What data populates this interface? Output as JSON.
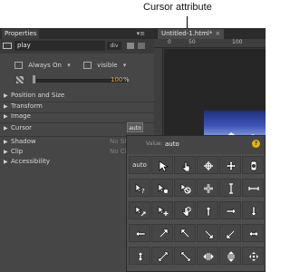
{
  "callout": {
    "text": "Cursor attribute"
  },
  "properties_panel": {
    "tab_label": "Properties",
    "menu_glyph": "▾≡",
    "element_name": "play",
    "element_type": "div",
    "overflow": "Always On",
    "visibility": "visible",
    "opacity_value": "100",
    "opacity_unit": "%",
    "categories": [
      {
        "label": "Position and Size",
        "expanded": false
      },
      {
        "label": "Transform",
        "expanded": false
      },
      {
        "label": "Image",
        "expanded": false
      },
      {
        "label": "Cursor",
        "expanded": false,
        "value": "auto"
      },
      {
        "label": "Shadow",
        "expanded": false,
        "value": "No Sh"
      },
      {
        "label": "Clip",
        "expanded": false,
        "value": "No Cl"
      },
      {
        "label": "Accessibility",
        "expanded": false
      }
    ]
  },
  "document": {
    "tab_label": "Untitled-1.html*",
    "close_glyph": "×",
    "ruler_ticks": [
      "0",
      "50",
      "100"
    ]
  },
  "cursor_picker": {
    "value_label": "Value:",
    "value": "auto",
    "help_glyph": "?",
    "auto_label": "auto",
    "cursors": [
      "auto",
      "default",
      "pointer",
      "crosshair",
      "move",
      "wait",
      "help",
      "progress",
      "not-allowed",
      "cell",
      "text",
      "vertical-text",
      "alias",
      "copy",
      "no-drop",
      "n-resize",
      "e-resize",
      "s-resize",
      "w-resize",
      "ne-resize",
      "nw-resize",
      "se-resize",
      "sw-resize",
      "ew-resize",
      "ns-resize",
      "nesw-resize",
      "nwse-resize",
      "col-resize",
      "row-resize",
      "all-scroll"
    ]
  },
  "colors": {
    "panel_bg": "#464646",
    "header_bg": "#2d2d2d",
    "accent_value": "#f0a030",
    "help_badge": "#e8b400"
  }
}
